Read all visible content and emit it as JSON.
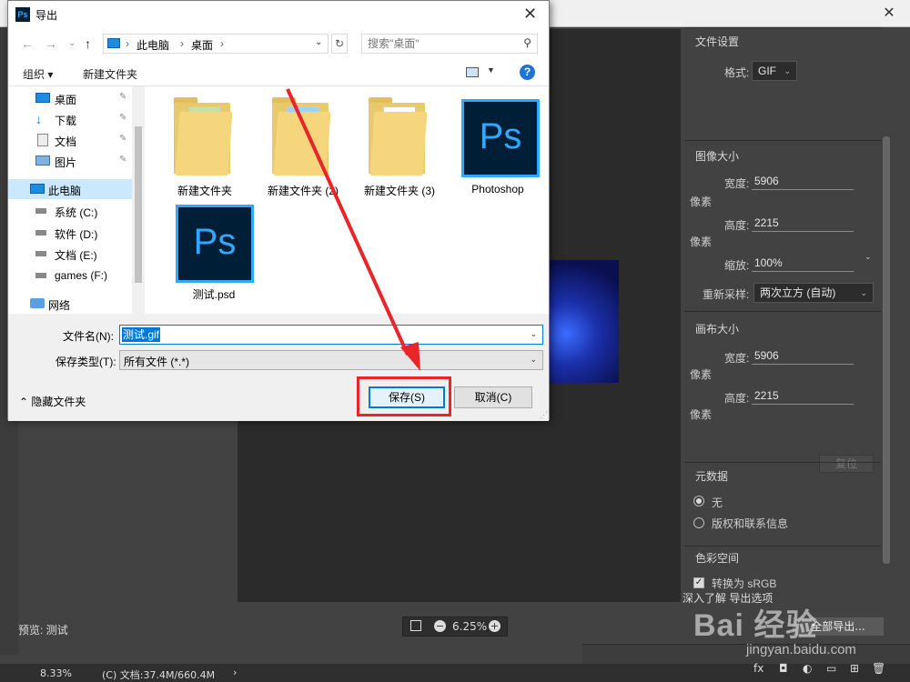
{
  "dialog": {
    "title": "导出",
    "close_glyph": "✕",
    "app_icon_text": "Ps",
    "nav": {
      "back": "←",
      "forward": "→",
      "up": "↑",
      "crumbs": [
        "此电脑",
        "桌面"
      ],
      "separator": "›",
      "dropdown": "⌄",
      "refresh": "↻"
    },
    "search": {
      "placeholder": "搜索\"桌面\"",
      "icon": "search-icon"
    },
    "toolbar": {
      "organize": "组织 ▾",
      "new_folder": "新建文件夹",
      "help": "?"
    },
    "nav_pane": {
      "items": [
        {
          "label": "桌面",
          "icon": "desktop-icon",
          "pinned": true
        },
        {
          "label": "下载",
          "icon": "download-icon",
          "pinned": true
        },
        {
          "label": "文档",
          "icon": "document-icon",
          "pinned": true
        },
        {
          "label": "图片",
          "icon": "picture-icon",
          "pinned": true
        },
        {
          "label": "此电脑",
          "icon": "computer-icon",
          "selected": true
        },
        {
          "label": "系统 (C:)",
          "icon": "drive-icon"
        },
        {
          "label": "软件 (D:)",
          "icon": "drive-icon"
        },
        {
          "label": "文档 (E:)",
          "icon": "drive-icon"
        },
        {
          "label": "games (F:)",
          "icon": "drive-icon"
        },
        {
          "label": "网络",
          "icon": "network-icon"
        }
      ],
      "pin_glyph": "📌"
    },
    "files": [
      {
        "label": "新建文件夹",
        "type": "folder"
      },
      {
        "label": "新建文件夹 (2)",
        "type": "folder"
      },
      {
        "label": "新建文件夹 (3)",
        "type": "folder"
      },
      {
        "label": "Photoshop",
        "type": "ps"
      },
      {
        "label": "测试.psd",
        "type": "ps"
      }
    ],
    "ps_tile_text": "Ps",
    "form": {
      "filename_label": "文件名(N):",
      "filename_value": "测试.gif",
      "filetype_label": "保存类型(T):",
      "filetype_value": "所有文件 (*.*)",
      "hide_folders": "隐藏文件夹",
      "save": "保存(S)",
      "cancel": "取消(C)",
      "caret": "⌄"
    }
  },
  "ps": {
    "close_glyph": "✕",
    "panel": {
      "file_settings_title": "文件设置",
      "format_label": "格式:",
      "format_value": "GIF",
      "image_size_title": "图像大小",
      "width_label": "宽度:",
      "width_value": "5906",
      "height_label": "高度:",
      "height_value": "2215",
      "unit_pixels": "像素",
      "scale_label": "缩放:",
      "scale_value": "100%",
      "resample_label": "重新采样:",
      "resample_value": "两次立方 (自动)",
      "canvas_size_title": "画布大小",
      "canvas_width_value": "5906",
      "canvas_height_value": "2215",
      "reset": "复位",
      "metadata_title": "元数据",
      "metadata_none": "无",
      "metadata_copyright": "版权和联系信息",
      "color_space_title": "色彩空间",
      "convert_srgb": "转换为 sRGB",
      "caret": "⌄"
    },
    "preview_label": "预览: 测试",
    "zoom_value": "6.25%",
    "learn_more": "深入了解 导出选项",
    "export_all": "全部导出...",
    "status_zoom": "8.33%",
    "status_doc": "(C) 文档:37.4M/660.4M",
    "status_more": "›"
  },
  "watermark": {
    "brand": "Bai 经验",
    "url": "jingyan.baidu.com"
  },
  "colors": {
    "annotation_red": "#e8262a",
    "ps_blue": "#31a8ff",
    "windows_accent": "#0078d7"
  }
}
